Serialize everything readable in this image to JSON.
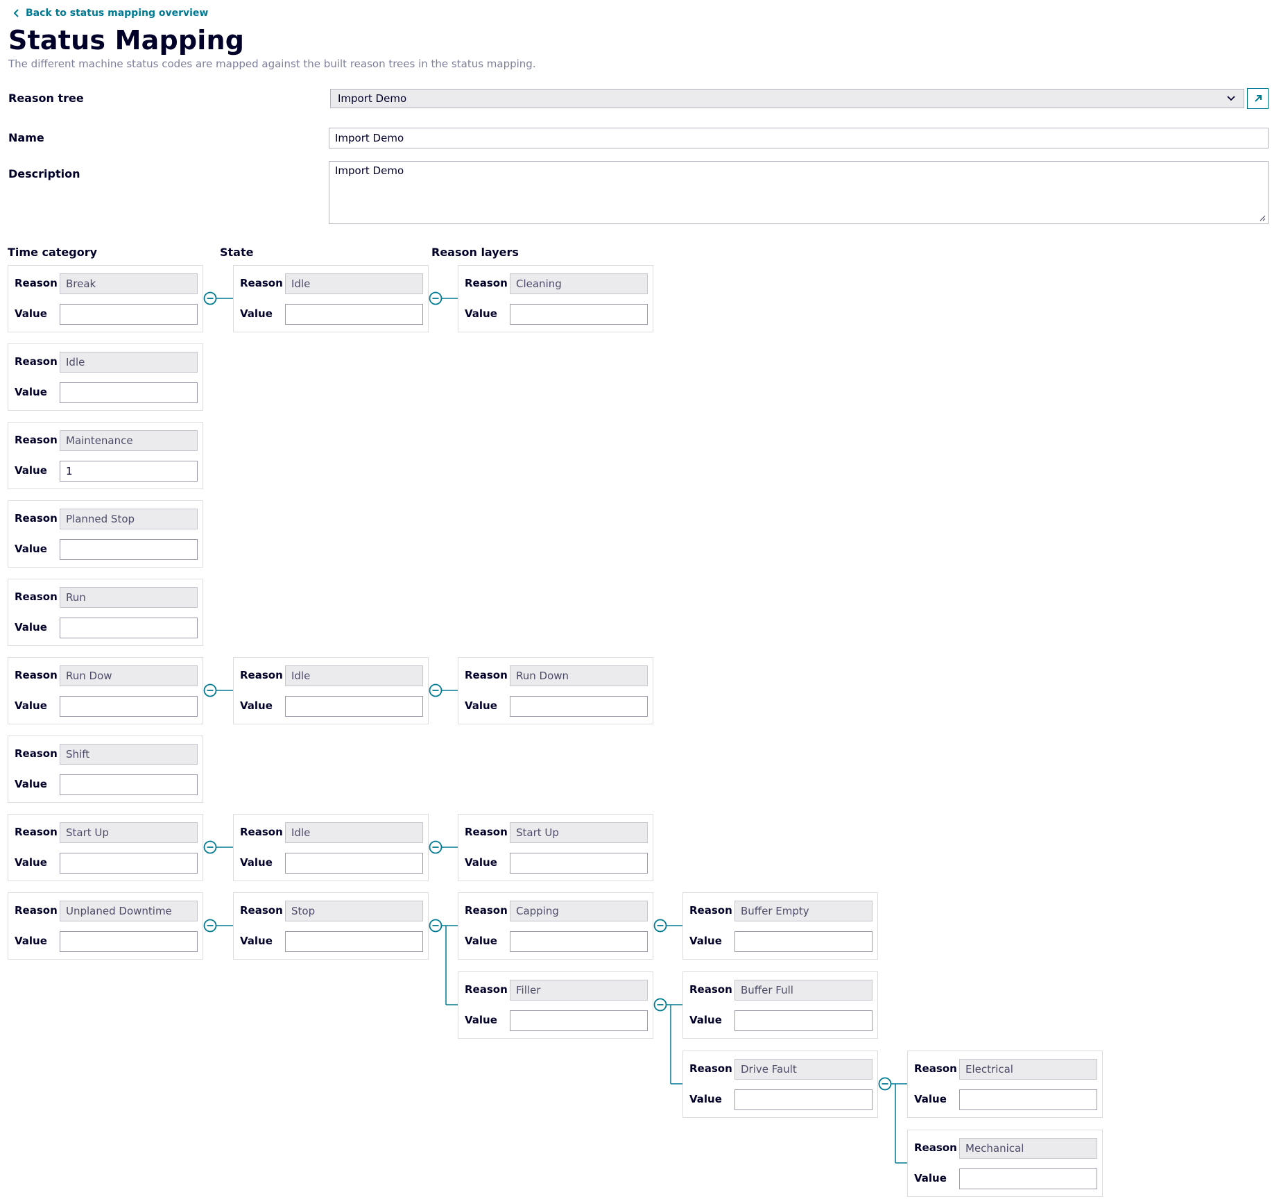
{
  "back_link": "Back to status mapping overview",
  "title": "Status Mapping",
  "subtitle": "The different machine status codes are mapped against the built reason trees in the status mapping.",
  "form": {
    "reason_tree_label": "Reason tree",
    "reason_tree_value": "Import Demo",
    "name_label": "Name",
    "name_value": "Import Demo",
    "description_label": "Description",
    "description_value": "Import Demo"
  },
  "columns": {
    "time_category": "Time category",
    "state": "State",
    "reason_layers": "Reason layers"
  },
  "labels": {
    "reason": "Reason",
    "value": "Value"
  },
  "cards": [
    {
      "reason": "Break",
      "value": ""
    },
    {
      "reason": "Idle",
      "value": ""
    },
    {
      "reason": "Cleaning",
      "value": ""
    },
    {
      "reason": "Idle",
      "value": ""
    },
    {
      "reason": "Maintenance",
      "value": "1"
    },
    {
      "reason": "Planned Stop",
      "value": ""
    },
    {
      "reason": "Run",
      "value": ""
    },
    {
      "reason": "Run Dow",
      "value": ""
    },
    {
      "reason": "Idle",
      "value": ""
    },
    {
      "reason": "Run Down",
      "value": ""
    },
    {
      "reason": "Shift",
      "value": ""
    },
    {
      "reason": "Start Up",
      "value": ""
    },
    {
      "reason": "Idle",
      "value": ""
    },
    {
      "reason": "Start Up",
      "value": ""
    },
    {
      "reason": "Unplaned Downtime",
      "value": ""
    },
    {
      "reason": "Stop",
      "value": ""
    },
    {
      "reason": "Capping",
      "value": ""
    },
    {
      "reason": "Buffer Empty",
      "value": ""
    },
    {
      "reason": "Filler",
      "value": ""
    },
    {
      "reason": "Buffer Full",
      "value": ""
    },
    {
      "reason": "Drive Fault",
      "value": ""
    },
    {
      "reason": "Electrical",
      "value": ""
    },
    {
      "reason": "Mechanical",
      "value": ""
    }
  ],
  "icons": {
    "back": "chevron-left-icon",
    "dropdown": "chevron-down-icon",
    "open": "arrow-up-right-icon",
    "collapse": "minus-circle-icon"
  },
  "colors": {
    "accent": "#007993",
    "text": "#000028",
    "muted": "#7d8099",
    "field_readonly": "#ebebee"
  }
}
